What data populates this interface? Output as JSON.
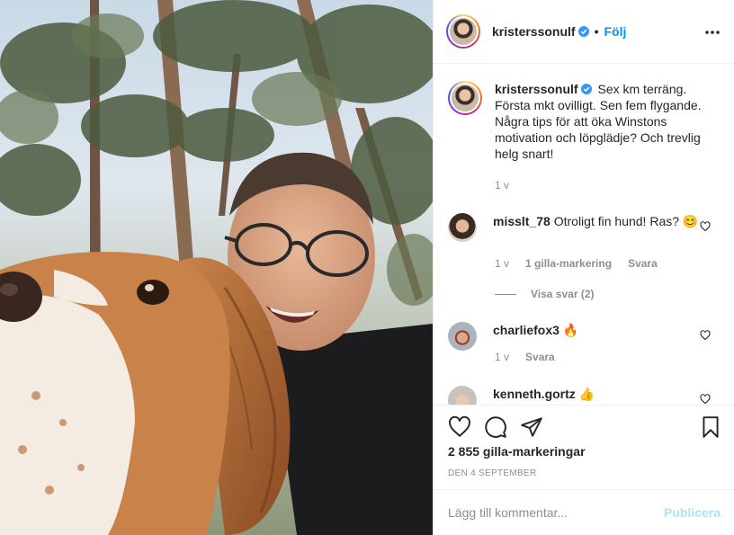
{
  "post": {
    "username": "kristerssonulf",
    "follow_label": "Följ",
    "separator": "•",
    "caption": "Sex km terräng. Första mkt ovilligt. Sen fem flygande. Några tips för att öka Winstons motivation och löpglädje? Och trevlig helg snart!",
    "caption_time": "1 v"
  },
  "comments": [
    {
      "username": "misslt_78",
      "text": "Otroligt fin hund! Ras? 😊",
      "time": "1 v",
      "likes": "1 gilla-markering",
      "reply": "Svara",
      "view_replies": "Visa svar (2)"
    },
    {
      "username": "charliefox3",
      "text": "🔥",
      "time": "1 v",
      "reply": "Svara"
    },
    {
      "username": "kenneth.gortz",
      "text": "👍"
    }
  ],
  "likes_count": "2 855 gilla-markeringar",
  "date": "DEN 4 SEPTEMBER",
  "add_comment": {
    "placeholder": "Lägg till kommentar...",
    "publish_label": "Publicera"
  },
  "icons": [
    "heart-icon",
    "comment-icon",
    "share-icon",
    "bookmark-icon",
    "more-icon",
    "verified-icon"
  ],
  "colors": {
    "link": "#0095f6",
    "publish_disabled": "#b2dffc",
    "muted": "#8e8e8e",
    "verified": "#3897f0"
  }
}
